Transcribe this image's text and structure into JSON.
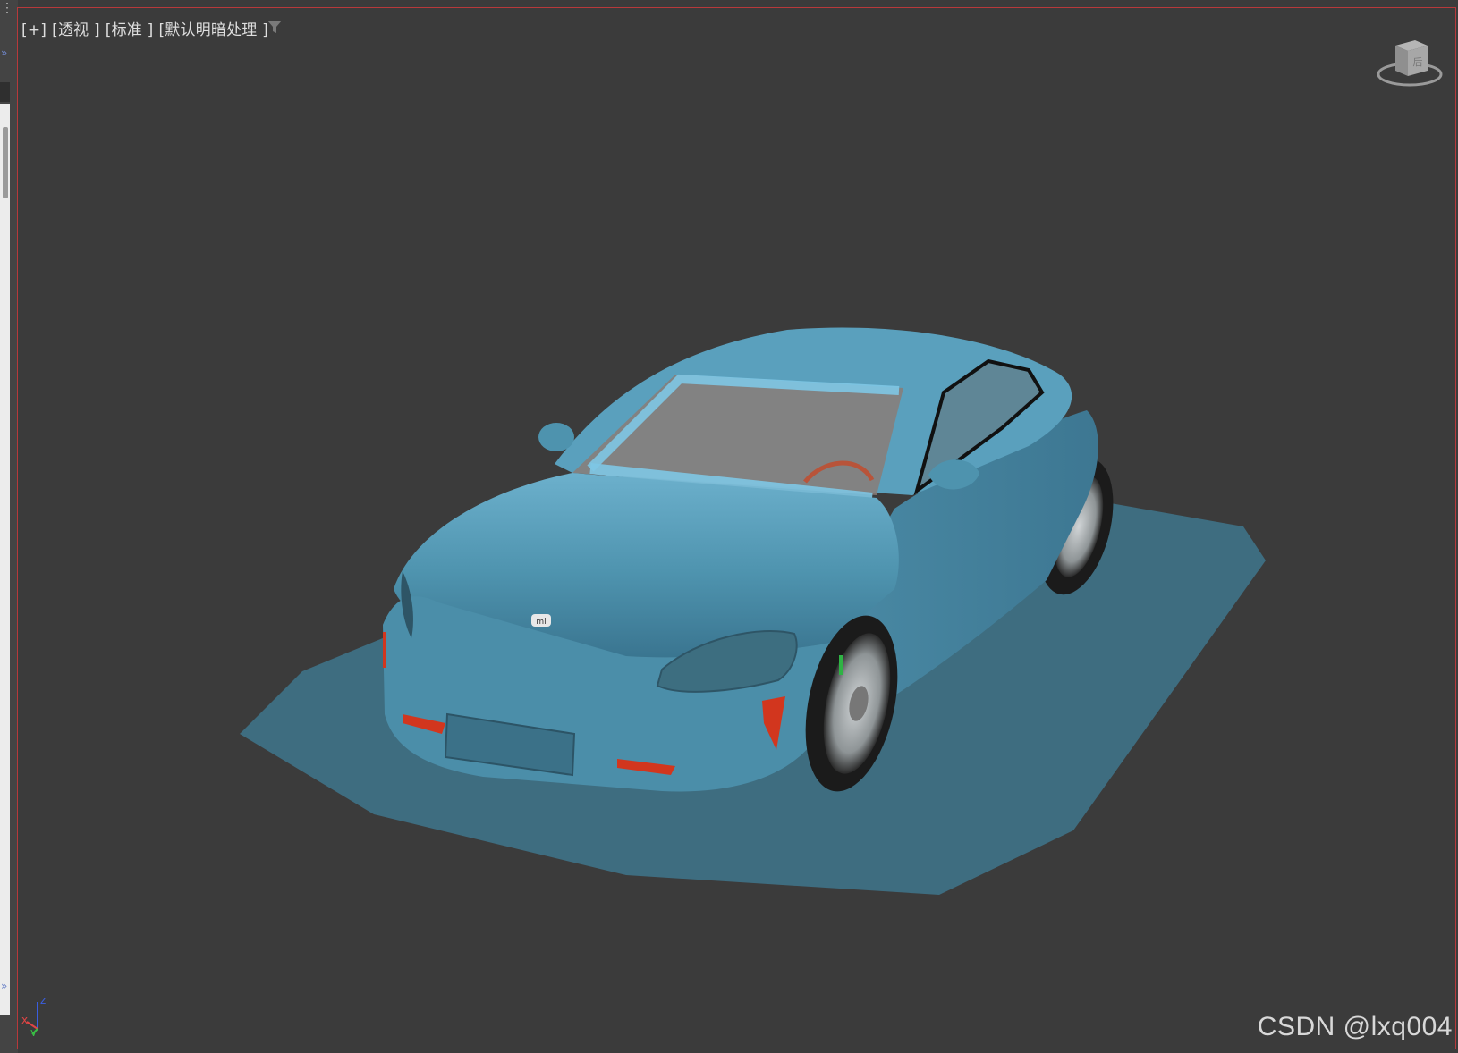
{
  "viewport": {
    "label_plus": "[+]",
    "label_view": "[透视 ]",
    "label_shading_std": "[标准 ]",
    "label_lighting": "[默认明暗处理 ]"
  },
  "viewcube": {
    "face_label": "后"
  },
  "axis": {
    "z": "z",
    "x": "x",
    "y": "y"
  },
  "watermark": "CSDN @lxq004",
  "model": {
    "badge": "mi"
  },
  "colors": {
    "background": "#3b3b3b",
    "body": "#4e93ae",
    "ground": "#3e6d80",
    "accent_red": "#d2361e",
    "border": "#b7393b"
  }
}
